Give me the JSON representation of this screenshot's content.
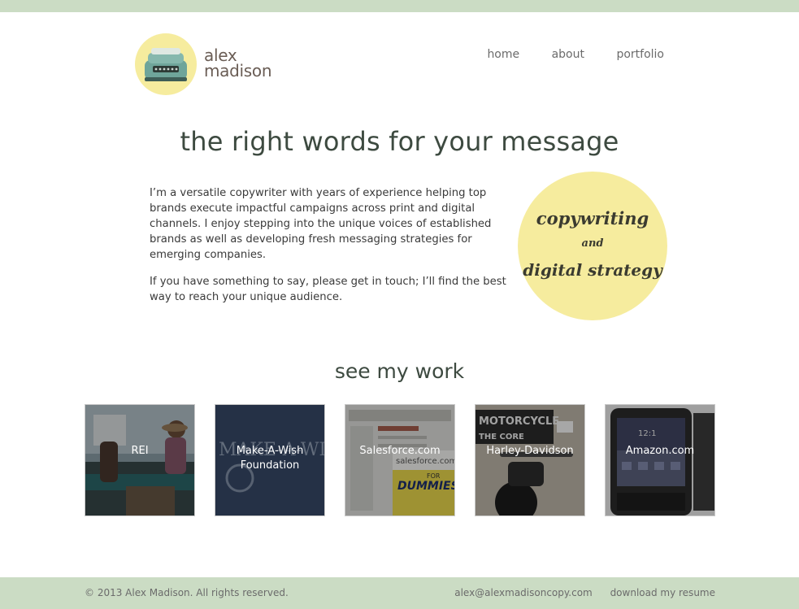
{
  "brand": {
    "line1": "alex",
    "line2": "madison"
  },
  "nav": {
    "home": "home",
    "about": "about",
    "portfolio": "portfolio"
  },
  "hero": {
    "headline": "the right words for your message",
    "p1": "I’m a versatile copywriter with years of experience helping top brands execute impactful campaigns across print and digital channels. I enjoy stepping into the unique voices of established brands as well as developing fresh messaging strategies for emerging companies.",
    "p2": "If you have something to say, please get in touch; I’ll find the best way to reach your unique audience.",
    "badge": {
      "line1": "copywriting",
      "line2": "and",
      "line3": "digital strategy"
    }
  },
  "work": {
    "heading": "see my work",
    "items": [
      {
        "label": "REI"
      },
      {
        "label": "Make-A-Wish Foundation"
      },
      {
        "label": "Salesforce.com"
      },
      {
        "label": "Harley-Davidson"
      },
      {
        "label": "Amazon.com"
      }
    ],
    "image_text": {
      "makeawish": "MAKE-A-WISH.",
      "book_site": "salesforce.com",
      "book_for": "FOR",
      "book_title": "DUMMIES",
      "moto_line1": "MOTORCYCLE",
      "moto_line2": "THE CORE",
      "phone_time": "12:1"
    }
  },
  "footer": {
    "copyright": "© 2013 Alex Madison. All rights reserved.",
    "email": "alex@alexmadisoncopy.com",
    "resume": "download my resume"
  },
  "colors": {
    "accent_green": "#cbdcc4",
    "accent_yellow": "#f6ec9e",
    "text_dark": "#3d4a40"
  }
}
